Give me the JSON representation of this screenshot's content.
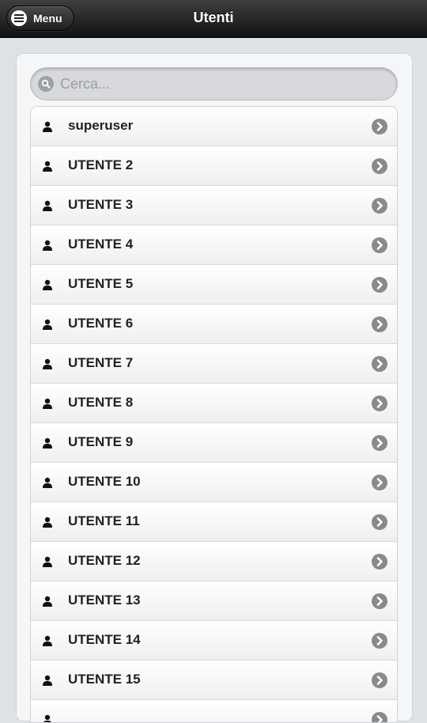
{
  "header": {
    "menu_label": "Menu",
    "menu_icon": "hamburger-icon",
    "title": "Utenti"
  },
  "search": {
    "placeholder": "Cerca...",
    "value": "",
    "icon": "search-icon"
  },
  "list": {
    "item_icon": "user-icon",
    "arrow_icon": "chevron-right-circle-icon",
    "items": [
      {
        "label": "superuser"
      },
      {
        "label": "UTENTE 2"
      },
      {
        "label": "UTENTE 3"
      },
      {
        "label": "UTENTE 4"
      },
      {
        "label": "UTENTE 5"
      },
      {
        "label": "UTENTE 6"
      },
      {
        "label": "UTENTE 7"
      },
      {
        "label": "UTENTE 8"
      },
      {
        "label": "UTENTE 9"
      },
      {
        "label": "UTENTE 10"
      },
      {
        "label": "UTENTE 11"
      },
      {
        "label": "UTENTE 12"
      },
      {
        "label": "UTENTE 13"
      },
      {
        "label": "UTENTE 14"
      },
      {
        "label": "UTENTE 15"
      },
      {
        "label": ""
      }
    ]
  },
  "colors": {
    "header_dark": "#111111",
    "page_bg": "#dfe2e5",
    "arrow_gray": "#8a8a8a"
  }
}
